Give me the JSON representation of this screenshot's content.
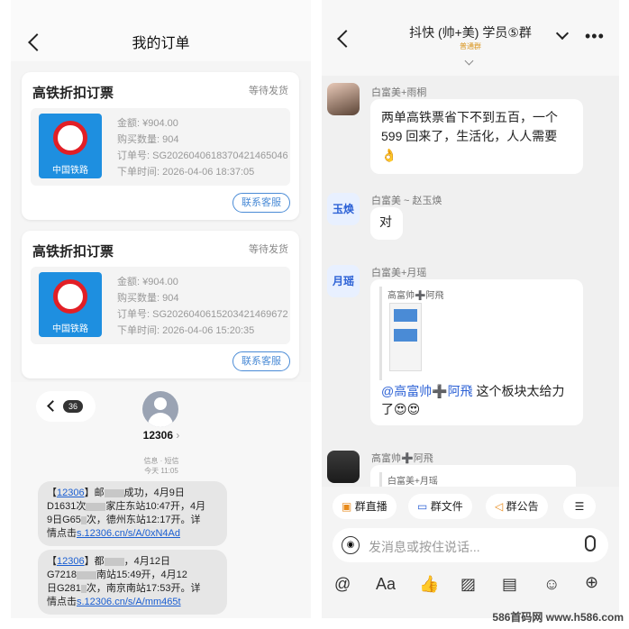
{
  "orders": {
    "title": "我的订单",
    "cards": [
      {
        "title": "高铁折扣订票",
        "status": "等待发货",
        "logo_label": "中国铁路",
        "amount": "金额: ¥904.00",
        "quantity": "购买数量: 904",
        "order_no": "订单号: SG20260406183704214650​46",
        "time": "下单时间: 2026-04-06 18:37:05",
        "contact": "联系客服"
      },
      {
        "title": "高铁折扣订票",
        "status": "等待发货",
        "logo_label": "中国铁路",
        "amount": "金额: ¥904.00",
        "quantity": "购买数量: 904",
        "order_no": "订单号: SG20260406152034214696​72",
        "time": "下单时间: 2026-04-06 15:20:35",
        "contact": "联系客服"
      }
    ]
  },
  "sms": {
    "unread_count": "36",
    "sender": "12306",
    "chevron": "›",
    "meta": "信息 · 短信",
    "time": "今天 11:05",
    "messages": [
      {
        "prefix": "【",
        "link1": "12306",
        "text1": "】",
        "frag1": "邮",
        "text2": "成功，4月9日",
        "text3": "D1631次",
        "text4": "家庄东站10:47开，4月",
        "text5": "9日G65",
        "text6": "次，德州东站12:17开。详",
        "text7": "情点击",
        "link2": "s.12306.cn/s/A/0xN4Ad"
      },
      {
        "prefix": "【",
        "link1": "12306",
        "text1": "】",
        "frag1": "都",
        "text2": "，4月12日",
        "text3": "G7218",
        "text4": "南站15:49开，4月12",
        "text5": "日G281",
        "text6": "次，南京南站17:53开。详",
        "text7": "情点击",
        "link2": "s.12306.cn/s/A/mm465t"
      }
    ]
  },
  "chat": {
    "group_name": "抖快 (帅+美) 学员⑤群",
    "group_tag": "普通群",
    "more": "•••",
    "messages": [
      {
        "sender": "白富美+雨桐",
        "text": "两单高铁票省下不到五百，一个599 回来了，生活化，人人需要",
        "emoji": "👌"
      },
      {
        "sender": "白富美 ~ 赵玉焕",
        "avatar_text": "玉焕",
        "text": "对"
      },
      {
        "sender": "白富美+月瑶",
        "avatar_text": "月瑶",
        "quote_title": "高富帅➕阿飛",
        "mention": "@高富帅➕阿飛",
        "text": " 这个板块太给力了",
        "emoji": "😍😍"
      },
      {
        "sender": "高富帅➕阿飛",
        "quote_title": "白富美+月瑶"
      }
    ],
    "toolbar": [
      {
        "icon": "live-icon",
        "label": "群直播"
      },
      {
        "icon": "folder-icon",
        "label": "群文件"
      },
      {
        "icon": "announcement-icon",
        "label": "群公告"
      }
    ],
    "input_placeholder": "发消息或按住说话...",
    "bottom_icons": [
      "at-icon",
      "font-icon",
      "like-icon",
      "image-icon",
      "screenshot-icon",
      "emoji-icon",
      "plus-icon"
    ]
  },
  "watermark": "586首码网 www.h586.com"
}
